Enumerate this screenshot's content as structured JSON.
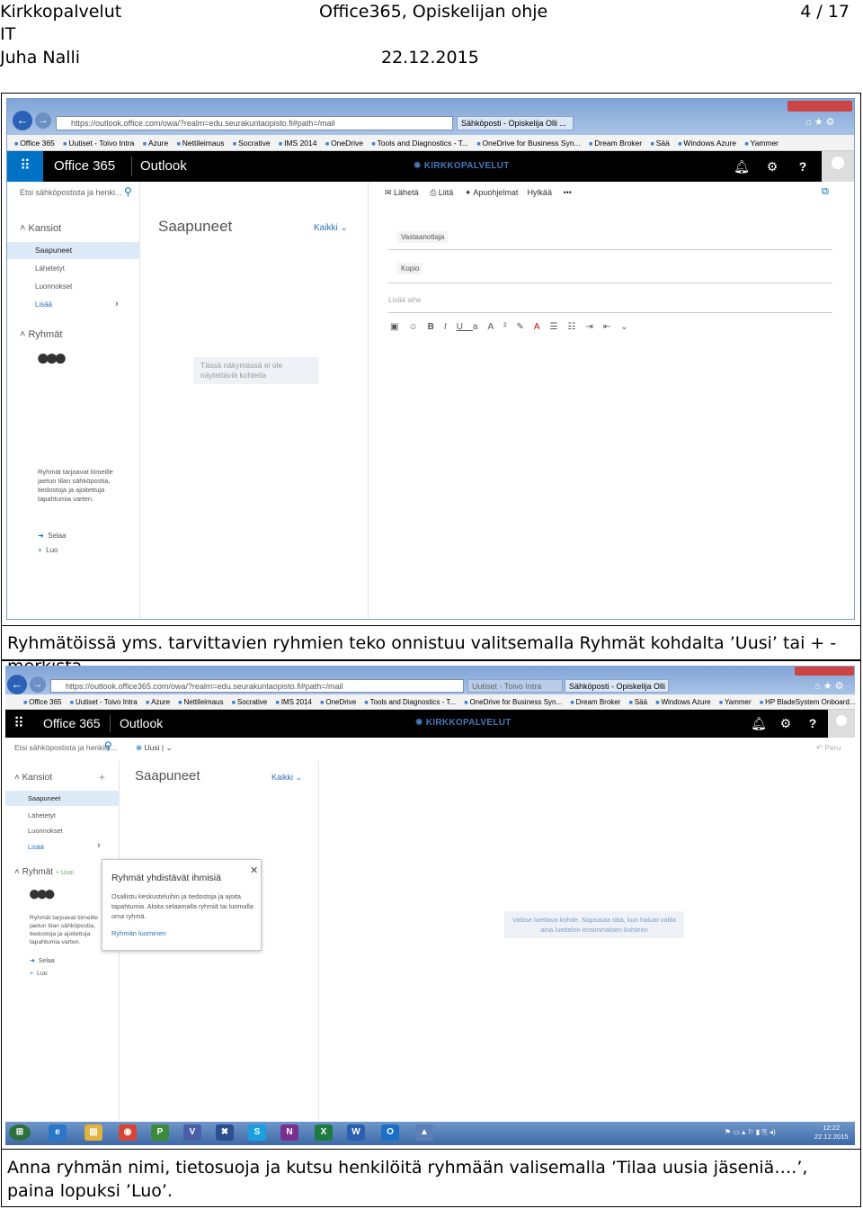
{
  "header": {
    "org_line1": "Kirkkopalvelut",
    "org_line2": "IT",
    "title": "Office365, Opiskelijan ohje",
    "page": "4 / 17",
    "author": "Juha Nalli",
    "date": "22.12.2015"
  },
  "caption1": "Ryhmätöissä yms. tarvittavien ryhmien teko onnistuu valitsemalla Ryhmät kohdalta ’Uusi’ tai + - merkistä",
  "caption2": "Anna ryhmän nimi, tietosuoja ja kutsu henkilöitä ryhmään valisemalla ’Tilaa uusia jäseniä….’, paina lopuksi ’Luo’.",
  "shot1": {
    "url": "https://outlook.office.com/owa/?realm=edu.seurakuntaopisto.fi#path=/mail",
    "tab_active": "Sähköposti - Opiskelija Olli ...",
    "favorites": [
      "Office 365",
      "Uutiset - Toivo Intra",
      "Azure",
      "Nettileimaus",
      "Socrative",
      "IMS 2014",
      "OneDrive",
      "Tools and Diagnostics - T...",
      "OneDrive for Business Syn...",
      "Dream Broker",
      "Sää",
      "Windows Azure",
      "Yammer"
    ],
    "suite_brand": "Office 365",
    "suite_app": "Outlook",
    "logo_text": "KIRKKOPALVELUT",
    "search_placeholder": "Etsi sähköpostista ja henki...",
    "actions": {
      "send": "Lähetä",
      "attach": "Liitä",
      "addins": "Apuohjelmat",
      "discard": "Hylkää",
      "more": "•••"
    },
    "folders_header": "Kansiot",
    "folders": [
      "Saapuneet",
      "Lähetetyt",
      "Luonnokset",
      "Lisää"
    ],
    "groups_header": "Ryhmät",
    "groups_desc": "Ryhmät tarjoavat tiimeille jaetun tilan sähköpostia, tiedostoja ja ajoitettuja tapahtumia varten.",
    "groups_browse": "Selaa",
    "groups_create": "Luo",
    "list_title": "Saapuneet",
    "list_filter": "Kaikki",
    "empty_text": "Tässä näkymässä ei ole näytettäviä kohteita",
    "to_label": "Vastaanottaja",
    "cc_label": "Kopio",
    "subject_placeholder": "Lisää aihe"
  },
  "shot2": {
    "url": "https://outlook.office365.com/owa/?realm=edu.seurakuntaopisto.fi#path=/mail",
    "tab_inactive": "Uutiset - Toivo Intra",
    "tab_active": "Sähköposti - Opiskelija Olli ...",
    "favorites": [
      "Office 365",
      "Uutiset - Toivo Intra",
      "Azure",
      "Nettileimaus",
      "Socrative",
      "IMS 2014",
      "OneDrive",
      "Tools and Diagnostics - T...",
      "OneDrive for Business Syn...",
      "Dream Broker",
      "Sää",
      "Windows Azure",
      "Yammer",
      "HP BladeSystem Onboard..."
    ],
    "suite_brand": "Office 365",
    "suite_app": "Outlook",
    "logo_text": "KIRKKOPALVELUT",
    "search_placeholder": "Etsi sähköpostista ja henkilö...",
    "new_button": "Uusi",
    "undo": "Peru",
    "folders_header": "Kansiot",
    "folders": [
      "Saapuneet",
      "Lähetetyt",
      "Luonnokset",
      "Lisää"
    ],
    "groups_header": "Ryhmät",
    "groups_new": "Uusi",
    "groups_desc": "Ryhmät tarjoavat tiimeille jaetun tilan sähköpostia, tiedostoja ja ajoitettuja tapahtumia varten.",
    "groups_browse": "Selaa",
    "groups_create": "Luo",
    "list_title": "Saapuneet",
    "list_filter": "Kaikki",
    "popup_title": "Ryhmät yhdistävät ihmisiä",
    "popup_body": "Osallistu keskusteluihin ja tiedostoja ja ajoita tapahtumia. Aloita selaamalla ryhmiä tai luomalla oma ryhmä.",
    "popup_link": "Ryhmän luominen",
    "reading_hint": "Valitse luettava kohde. Napsauta tätä, kun haluat valita aina luettelon ensimmäisen kohteen",
    "clock_time": "12:22",
    "clock_date": "22.12.2015"
  }
}
